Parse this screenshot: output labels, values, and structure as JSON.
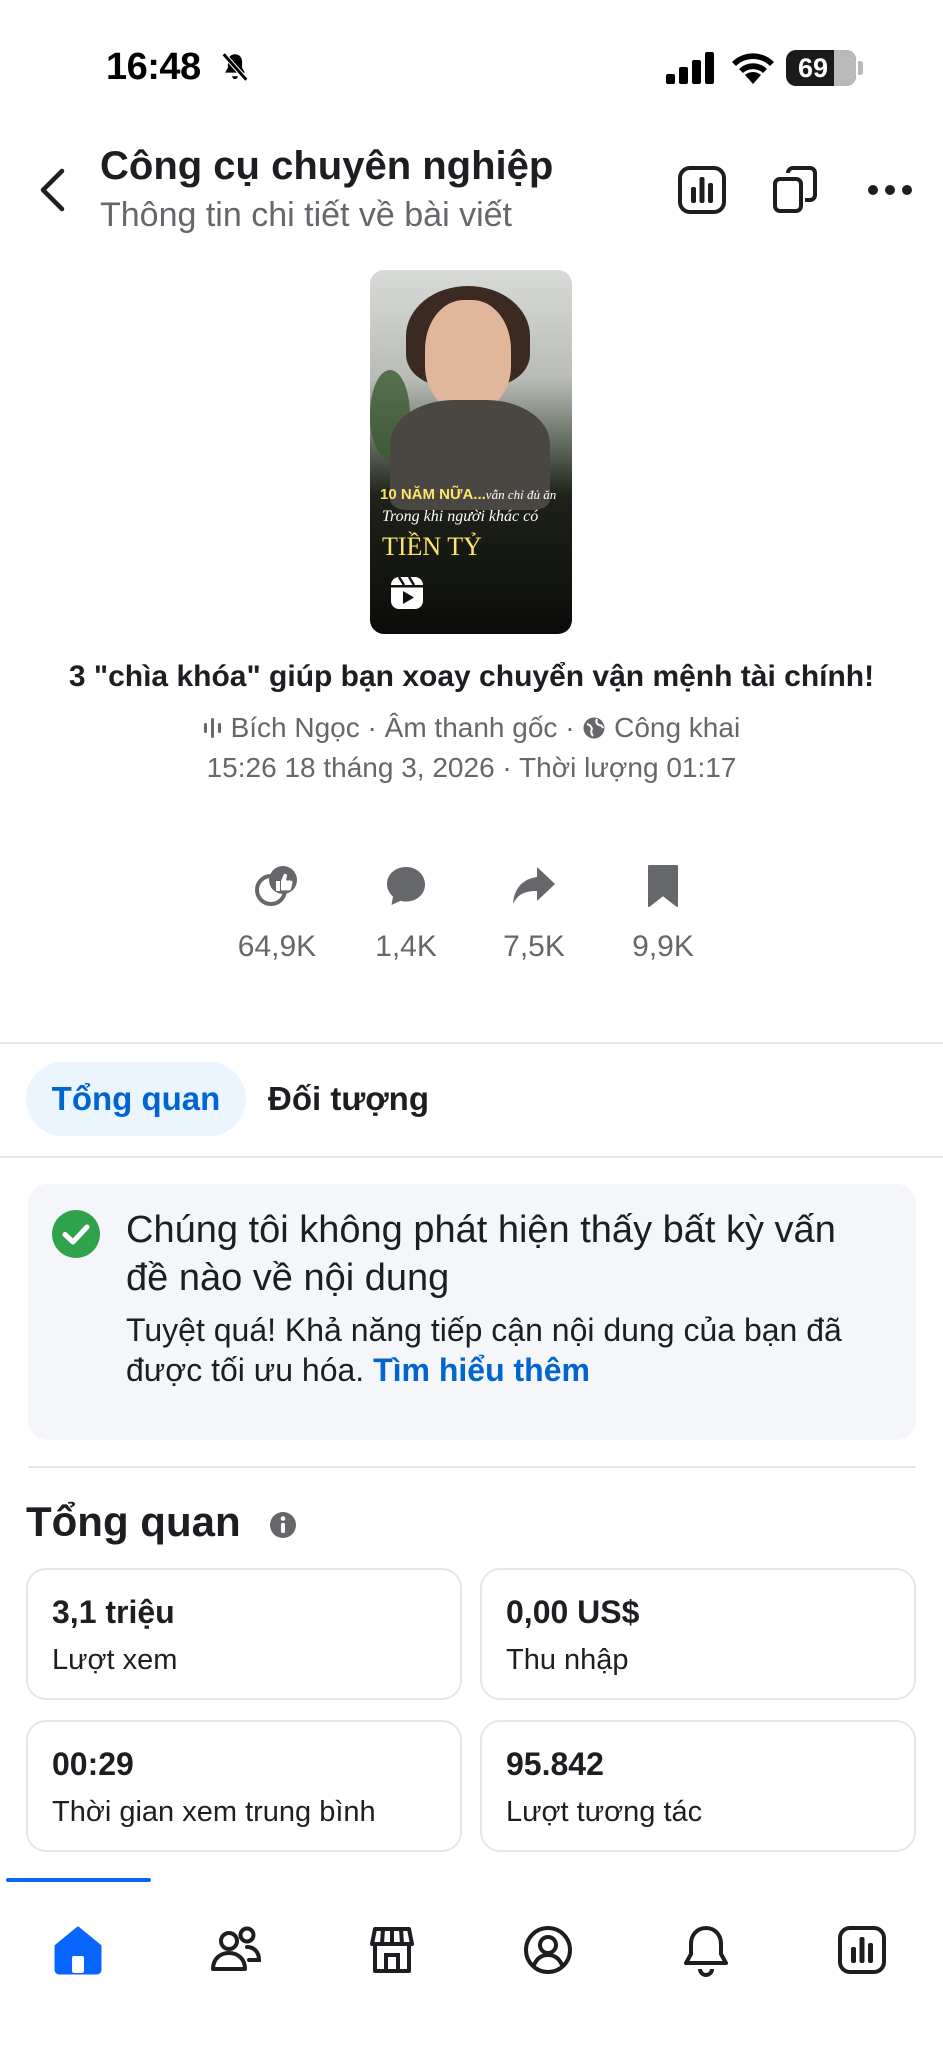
{
  "status_bar": {
    "time": "16:48",
    "battery": "69",
    "icons": [
      "bell-slash-icon",
      "signal-icon",
      "wifi-icon",
      "battery-icon"
    ]
  },
  "header": {
    "title": "Công cụ chuyên nghiệp",
    "subtitle": "Thông tin chi tiết về bài viết",
    "icons": [
      "back-icon",
      "insights-icon",
      "copy-icon",
      "more-icon"
    ]
  },
  "post": {
    "thumbnail_text": {
      "line1_bold": "10 NĂM NỮA...",
      "line1_italic": "vẫn chỉ đủ ăn",
      "line2": "Trong khi người khác có",
      "line3": "TIỀN TỶ"
    },
    "title": "3 \"chìa khóa\" giúp bạn xoay chuyển vận mệnh tài chính!",
    "author": "Bích Ngọc",
    "sep": "·",
    "audio": "Âm thanh gốc",
    "privacy": "Công khai",
    "date_line": "15:26 18 tháng 3, 2026 · Thời lượng 01:17"
  },
  "stats": [
    {
      "icon": "reactions-icon",
      "value": "64,9K"
    },
    {
      "icon": "comment-icon",
      "value": "1,4K"
    },
    {
      "icon": "share-icon",
      "value": "7,5K"
    },
    {
      "icon": "bookmark-icon",
      "value": "9,9K"
    }
  ],
  "tabs": [
    {
      "label": "Tổng quan",
      "active": true
    },
    {
      "label": "Đối tượng",
      "active": false
    }
  ],
  "notice": {
    "title": "Chúng tôi không phát hiện thấy bất kỳ vấn đề nào về nội dung",
    "body": "Tuyệt quá! Khả năng tiếp cận nội dung của bạn đã được tối ưu hóa.",
    "link": "Tìm hiểu thêm"
  },
  "overview": {
    "title": "Tổng quan",
    "cards": [
      {
        "value": "3,1 triệu",
        "label": "Lượt xem"
      },
      {
        "value": "0,00 US$",
        "label": "Thu nhập"
      },
      {
        "value": "00:29",
        "label": "Thời gian xem trung bình"
      },
      {
        "value": "95.842",
        "label": "Lượt tương tác"
      }
    ]
  },
  "bottom_nav": {
    "items": [
      "home-icon",
      "audience-icon",
      "shop-icon",
      "profile-icon",
      "notifications-icon",
      "insights-icon"
    ],
    "active_index": 0
  },
  "colors": {
    "accent": "#0064d1",
    "nav_active": "#0866ff",
    "success": "#31a24c",
    "muted": "#65676b"
  }
}
